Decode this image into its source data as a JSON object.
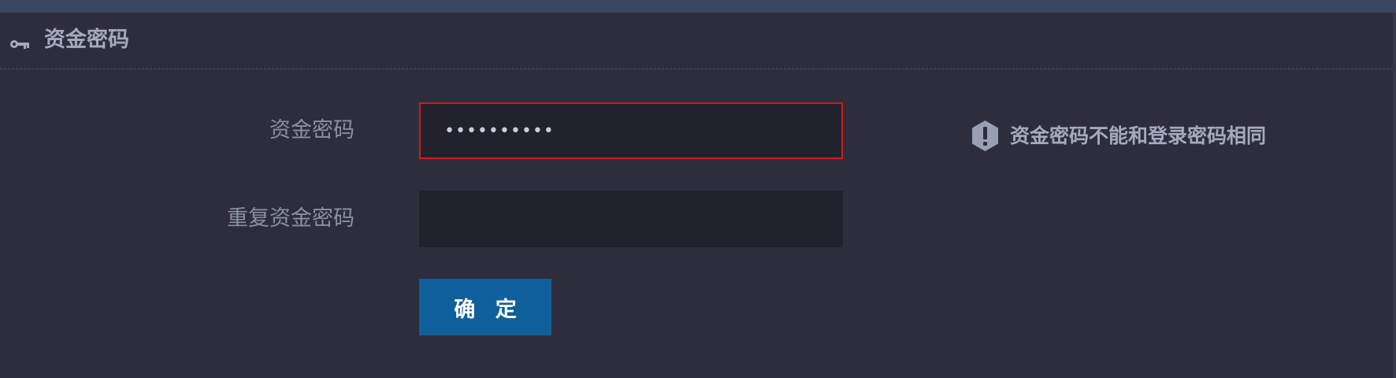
{
  "panel": {
    "title": "资金密码",
    "icon": "key-icon"
  },
  "form": {
    "password_label": "资金密码",
    "password_value": "••••••••••",
    "repeat_label": "重复资金密码",
    "repeat_value": "",
    "confirm_label": "确 定"
  },
  "hint": {
    "icon": "exclamation-icon",
    "text": "资金密码不能和登录密码相同"
  },
  "colors": {
    "background": "#2d2d3d",
    "top_strip": "#3c4661",
    "input_background": "#22222e",
    "error_border": "#d71a1a",
    "button": "#0f5f9a",
    "text": "#9aa0b4"
  }
}
